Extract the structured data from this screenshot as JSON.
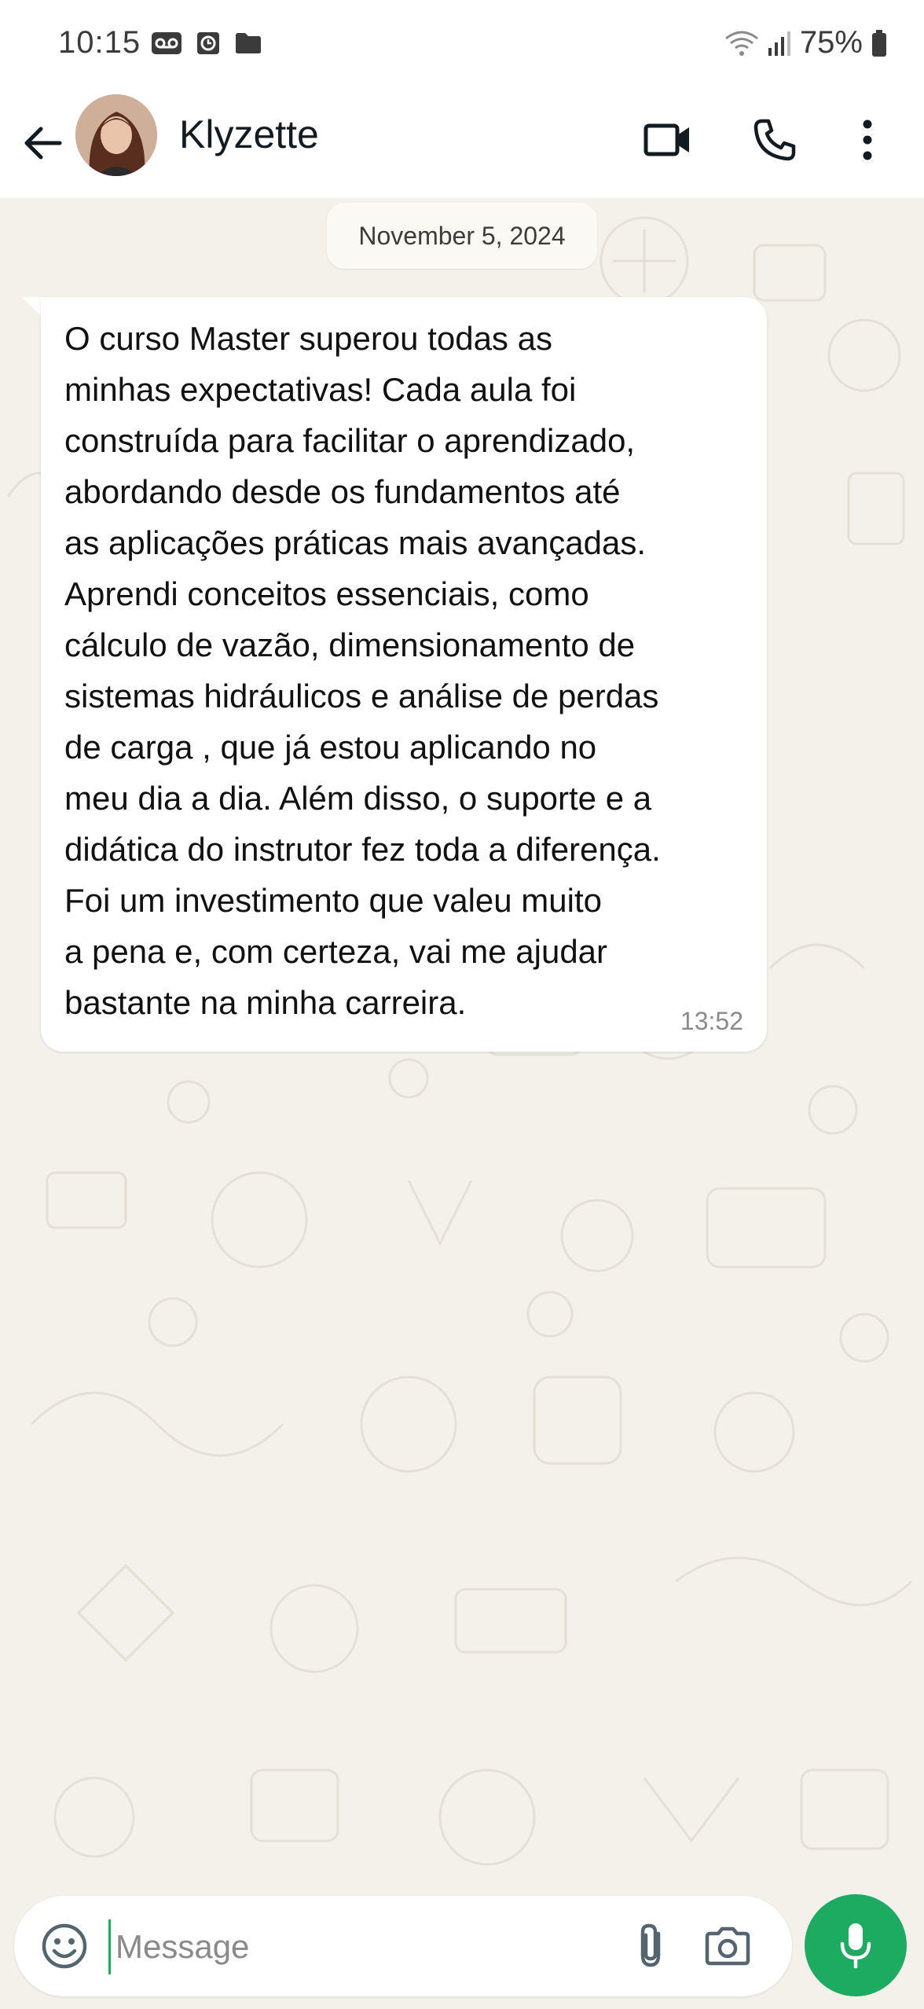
{
  "status_bar": {
    "time": "10:15",
    "battery": "75%",
    "left_icons": [
      "voicemail-icon",
      "clock-icon",
      "folder-icon"
    ],
    "right_icons": [
      "wifi-icon",
      "signal-icon",
      "battery-icon"
    ]
  },
  "header": {
    "contact_name": "Klyzette",
    "icons": [
      "back-arrow-icon",
      "video-call-icon",
      "phone-icon",
      "more-vert-icon"
    ]
  },
  "chat": {
    "date_label": "November 5, 2024",
    "messages": [
      {
        "direction": "incoming",
        "text": "O curso Master superou todas as\nminhas expectativas! Cada aula foi\nconstruída para facilitar o aprendizado,\nabordando desde os fundamentos até\nas aplicações práticas mais avançadas.\nAprendi conceitos essenciais, como\ncálculo de vazão, dimensionamento de\nsistemas hidráulicos e análise de perdas\nde carga , que já estou aplicando no\nmeu dia a dia. Além disso, o suporte e a\ndidática do instrutor fez toda a diferença.\nFoi um investimento que valeu muito\na pena e, com certeza, vai me ajudar\nbastante na minha carreira.",
        "time": "13:52"
      }
    ]
  },
  "input_bar": {
    "placeholder": "Message",
    "icons": [
      "emoji-icon",
      "attach-icon",
      "camera-icon",
      "mic-icon"
    ]
  },
  "colors": {
    "accent": "#1daa61",
    "chat_background": "#f4f1ea",
    "bubble": "#ffffff",
    "header": "#ffffff"
  }
}
